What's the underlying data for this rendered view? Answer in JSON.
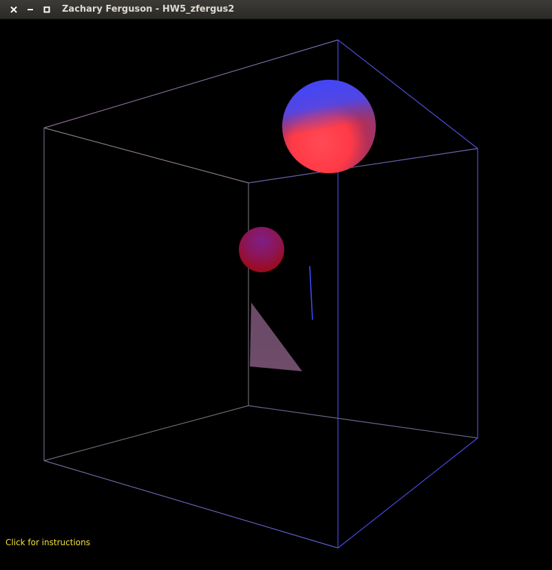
{
  "window": {
    "title": "Zachary Ferguson - HW5_zfergus2",
    "controls": {
      "close_icon": "close-icon",
      "minimize_icon": "minimize-icon",
      "maximize_icon": "maximize-icon"
    }
  },
  "viewport": {
    "background_color": "#000000",
    "instructions_label": "Click for instructions",
    "instructions_color": "#f2e23a"
  },
  "scene": {
    "objects": [
      "wireframe-cube",
      "large-sphere",
      "small-sphere",
      "triangle",
      "line-segment"
    ],
    "colors": {
      "cube_near_edge": "#4a4ae8",
      "cube_far_edge": "#8a6f8a",
      "large_sphere_top": "#3c46ff",
      "large_sphere_bottom": "#ff3c4a",
      "small_sphere_top": "#7a1a7a",
      "small_sphere_bottom": "#a60a0a",
      "triangle_fill": "#6e4a66",
      "line_segment": "#3c4aff"
    }
  }
}
